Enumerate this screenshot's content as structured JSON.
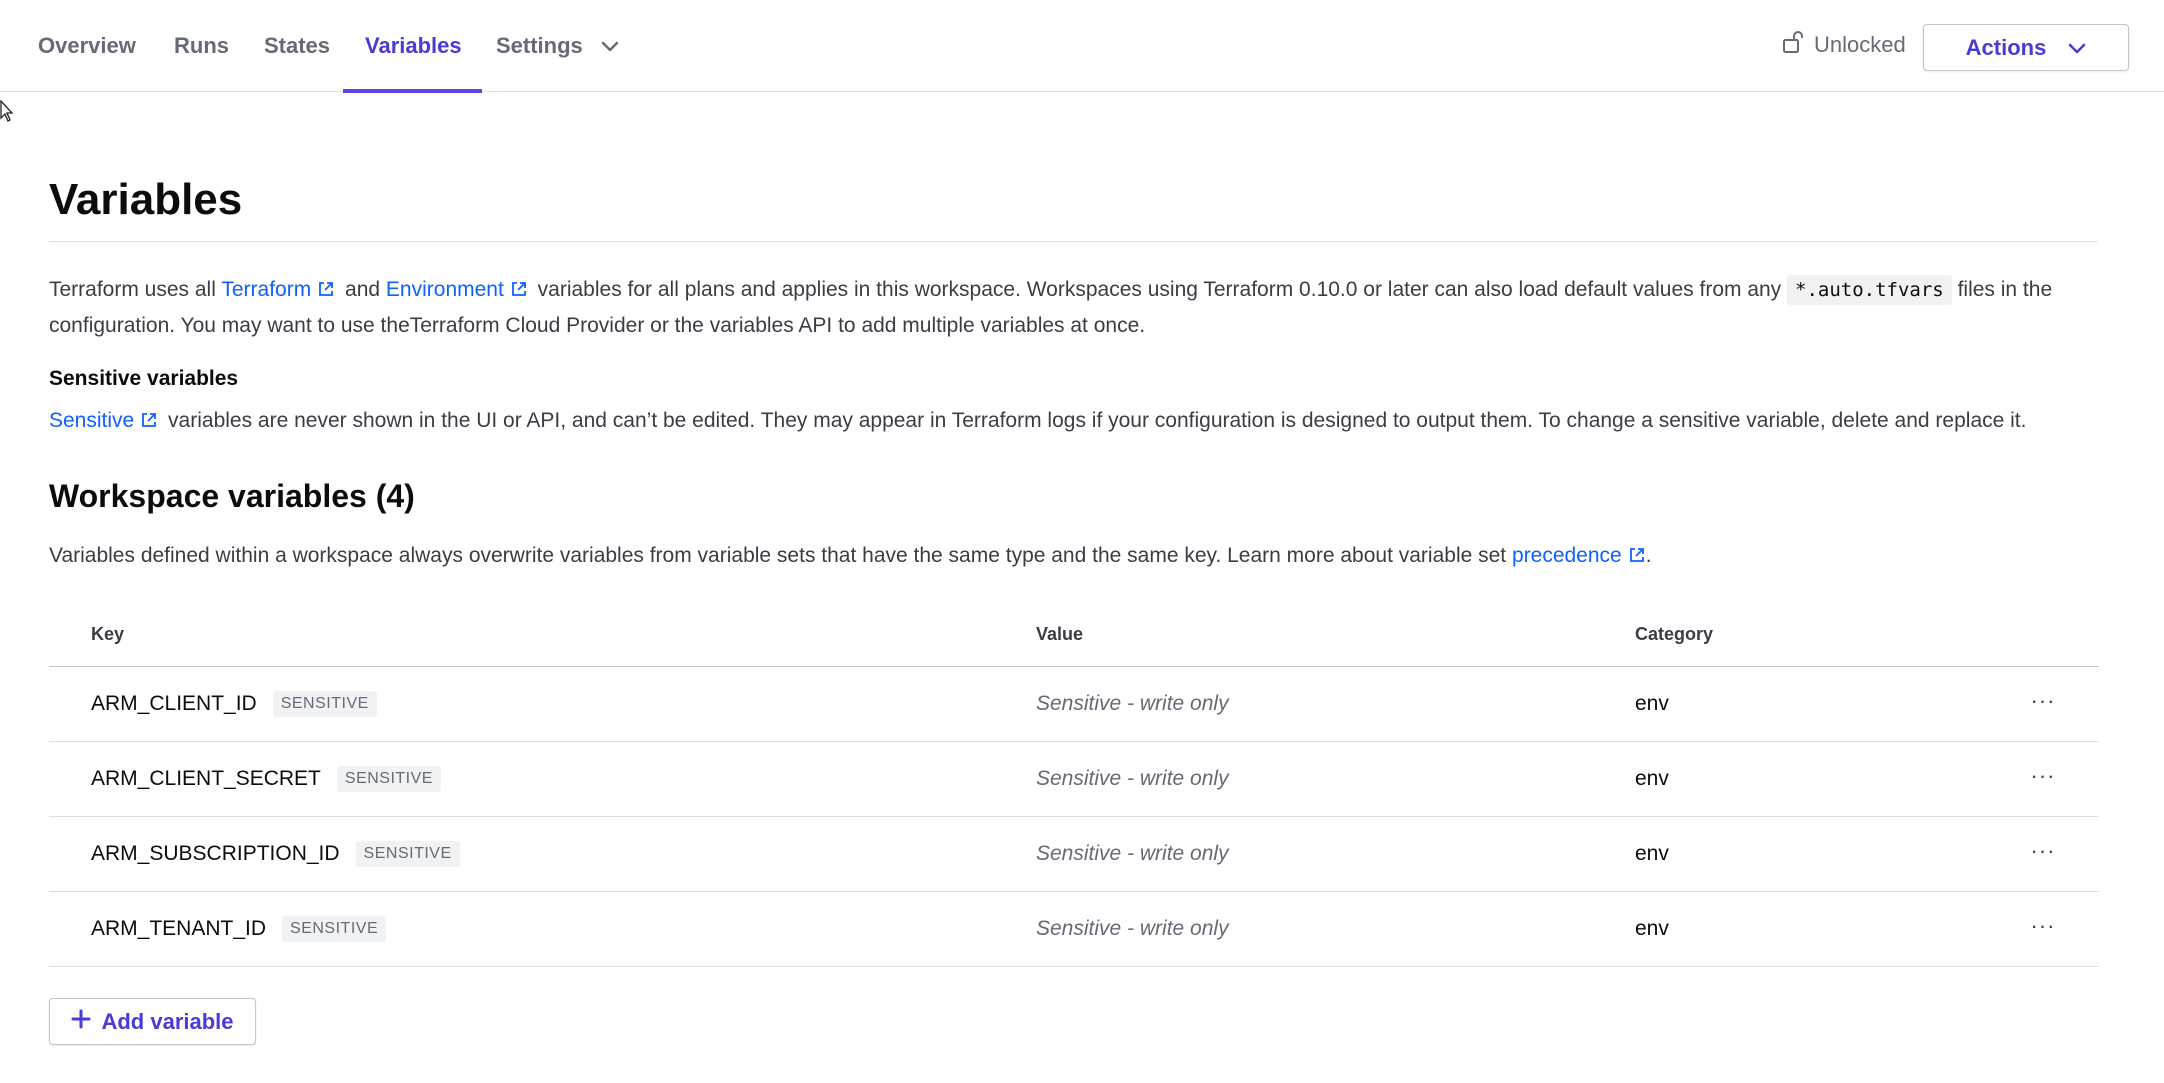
{
  "nav": {
    "tabs": [
      {
        "label": "Overview"
      },
      {
        "label": "Runs"
      },
      {
        "label": "States"
      },
      {
        "label": "Variables",
        "active": true
      },
      {
        "label": "Settings",
        "has_dropdown": true
      }
    ],
    "lock_status": "Unlocked",
    "actions_label": "Actions"
  },
  "page": {
    "title": "Variables",
    "intro": {
      "p1": "Terraform uses all ",
      "link_terraform": "Terraform",
      "p2": " and ",
      "link_environment": "Environment",
      "p3": " variables for all plans and applies in this workspace. Workspaces using Terraform 0.10.0 or later can also load default values from any ",
      "code": "*.auto.tfvars",
      "p4": " files in the configuration. You may want to use theTerraform Cloud Provider or the variables API to add multiple variables at once."
    },
    "sensitive": {
      "heading": "Sensitive variables",
      "link": "Sensitive",
      "text": " variables are never shown in the UI or API, and can’t be edited. They may appear in Terraform logs if your configuration is designed to output them. To change a sensitive variable, delete and replace it."
    }
  },
  "workspace": {
    "title": "Workspace variables (4)",
    "desc_text": "Variables defined within a workspace always overwrite variables from variable sets that have the same type and the same key. Learn more about variable set ",
    "desc_link": "precedence",
    "desc_end": ".",
    "columns": {
      "key": "Key",
      "value": "Value",
      "category": "Category"
    },
    "rows": [
      {
        "key": "ARM_CLIENT_ID",
        "badge": "SENSITIVE",
        "value": "Sensitive - write only",
        "category": "env"
      },
      {
        "key": "ARM_CLIENT_SECRET",
        "badge": "SENSITIVE",
        "value": "Sensitive - write only",
        "category": "env"
      },
      {
        "key": "ARM_SUBSCRIPTION_ID",
        "badge": "SENSITIVE",
        "value": "Sensitive - write only",
        "category": "env"
      },
      {
        "key": "ARM_TENANT_ID",
        "badge": "SENSITIVE",
        "value": "Sensitive - write only",
        "category": "env"
      }
    ],
    "row_menu_glyph": "···",
    "add_label": "Add variable"
  },
  "colors": {
    "accent": "#4a3ad6",
    "link": "#1060ff",
    "muted": "#656a76"
  }
}
